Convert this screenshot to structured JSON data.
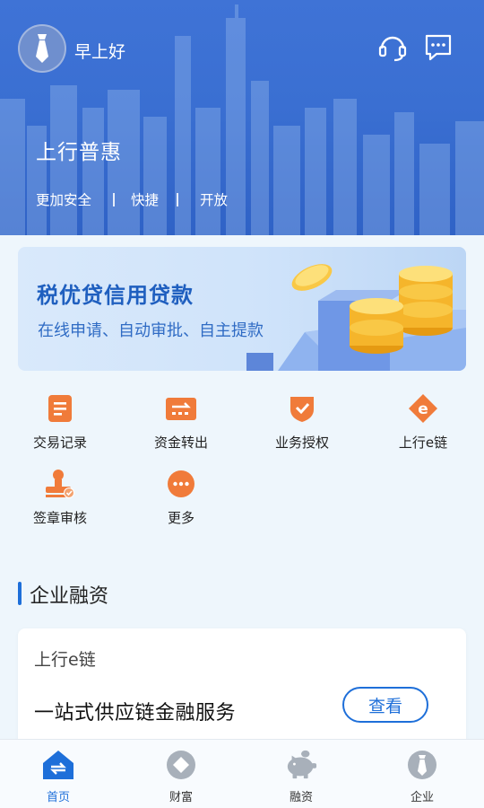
{
  "header": {
    "greeting": "早上好",
    "hero_title": "上行普惠",
    "taglines": [
      "更加安全",
      "快捷",
      "开放"
    ],
    "icons": {
      "avatar": "tie-avatar-icon",
      "support": "headset-icon",
      "message": "chat-bubble-icon"
    }
  },
  "banner": {
    "title": "税优贷信用贷款",
    "subtitle": "在线申请、自动审批、自主提款"
  },
  "services": [
    {
      "label": "交易记录",
      "icon": "document-list-icon",
      "color": "#f07b3a"
    },
    {
      "label": "资金转出",
      "icon": "transfer-out-icon",
      "color": "#f07b3a"
    },
    {
      "label": "业务授权",
      "icon": "shield-check-icon",
      "color": "#f07b3a"
    },
    {
      "label": "上行e链",
      "icon": "e-chain-icon",
      "color": "#f07b3a"
    },
    {
      "label": "签章审核",
      "icon": "stamp-review-icon",
      "color": "#f07b3a"
    },
    {
      "label": "更多",
      "icon": "more-dots-icon",
      "color": "#f07b3a"
    }
  ],
  "section": {
    "title": "企业融资",
    "card": {
      "subtitle": "上行e链",
      "main": "一站式供应链金融服务",
      "button": "查看"
    }
  },
  "bottom_nav": [
    {
      "label": "首页",
      "icon": "home-icon",
      "active": true
    },
    {
      "label": "财富",
      "icon": "wealth-diamond-icon",
      "active": false
    },
    {
      "label": "融资",
      "icon": "piggy-bank-icon",
      "active": false
    },
    {
      "label": "企业",
      "icon": "enterprise-tie-icon",
      "active": false
    }
  ],
  "colors": {
    "brand_blue": "#1e6fd9",
    "accent_orange": "#f07b3a",
    "hero_blue": "#3a6fd2"
  }
}
